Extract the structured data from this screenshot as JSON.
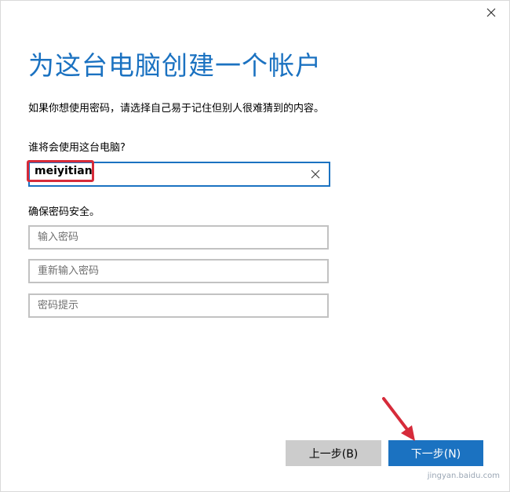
{
  "dialog": {
    "title": "为这台电脑创建一个帐户",
    "subtitle": "如果你想使用密码，请选择自己易于记住但别人很难猜到的内容。"
  },
  "user_section": {
    "label": "谁将会使用这台电脑?",
    "username_value": "meiyitian"
  },
  "password_section": {
    "label": "确保密码安全。",
    "password_placeholder": "输入密码",
    "reenter_placeholder": "重新输入密码",
    "hint_placeholder": "密码提示"
  },
  "buttons": {
    "back_label": "上一步(B)",
    "next_label": "下一步(N)"
  },
  "watermark": "jingyan.baidu.com",
  "icons": {
    "close": "close-icon",
    "clear": "clear-input-icon",
    "annotation_arrow": "arrow-icon"
  },
  "colors": {
    "accent": "#1b72c1",
    "highlight": "#d62b3a",
    "button_gray": "#cccccc"
  }
}
